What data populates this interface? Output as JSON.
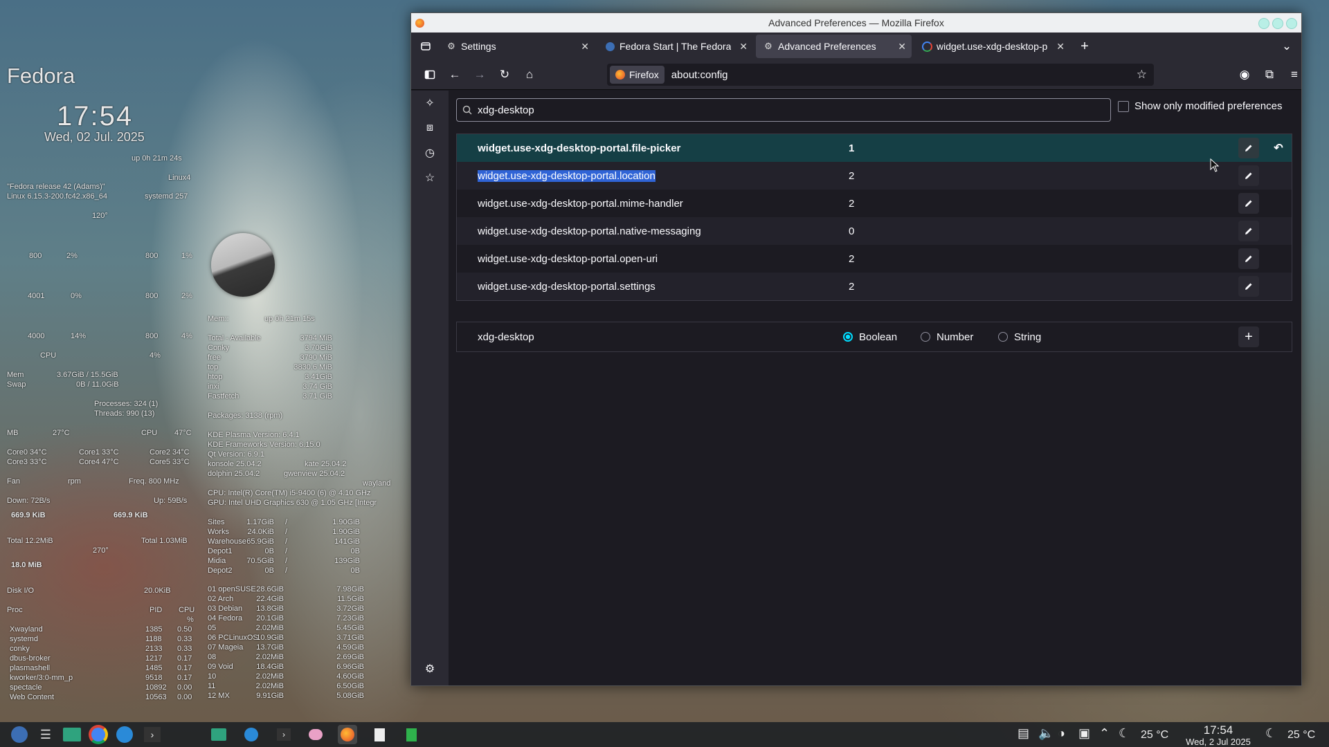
{
  "conky": {
    "distro_title": "Fedora",
    "time": "17:54",
    "date": "Wed, 02 Jul. 2025",
    "uptime": "up  0h 21m 24s",
    "kernel_short": "Linux4",
    "release": "\"Fedora release 42 (Adams)\"",
    "kernel": "Linux 6.15.3-200.fc42.x86_64",
    "systemd": "systemd 257",
    "angle_top": "120°",
    "cpu_rows": [
      {
        "a": "800",
        "b": "2%",
        "c": "800",
        "d": "1%"
      },
      {
        "a": "4001",
        "b": "0%",
        "c": "800",
        "d": "2%"
      },
      {
        "a": "4000",
        "b": "14%",
        "c": "800",
        "d": "4%"
      }
    ],
    "cpu_label": "CPU",
    "cpu_total": "4%",
    "mem_label": "Mem",
    "mem_value": "3.67GiB / 15.5GiB",
    "swap_label": "Swap",
    "swap_value": "0B / 11.0GiB",
    "processes": "Processes:   324 (1)",
    "threads": "Threads:   990 (13)",
    "mb_label": "MB",
    "mb_temp": "27°C",
    "cpu_temp_label": "CPU",
    "cpu_temp": "47°C",
    "cores": [
      "Core0  34°C",
      "Core1  33°C",
      "Core2  34°C",
      "Core3  33°C",
      "Core4  47°C",
      "Core5  33°C"
    ],
    "fan": "Fan",
    "rpm": "rpm",
    "freq": "Freq.  800   MHz",
    "down": "Down: 72B/s",
    "up": "Up: 59B/s",
    "down_kib": "669.9 KiB",
    "up_kib": "669.9 KiB",
    "total_down": "Total 12.2MiB",
    "total_up": "Total 1.03MiB",
    "angle_bottom": "270°",
    "io_mib": "18.0 MiB",
    "diskio_label": "Disk I/O",
    "diskio_value": "20.0KiB",
    "proc_header": {
      "name": "Proc",
      "pid": "PID",
      "cpu": "CPU",
      "pct": "%"
    },
    "procs": [
      {
        "name": "Xwayland",
        "pid": "1385",
        "cpu": "0.50"
      },
      {
        "name": "systemd",
        "pid": "1188",
        "cpu": "0.33"
      },
      {
        "name": "conky",
        "pid": "2133",
        "cpu": "0.33"
      },
      {
        "name": "dbus-broker",
        "pid": "1217",
        "cpu": "0.17"
      },
      {
        "name": "plasmashell",
        "pid": "1485",
        "cpu": "0.17"
      },
      {
        "name": "kworker/3:0-mm_p",
        "pid": "9518",
        "cpu": "0.17"
      },
      {
        "name": "spectacle",
        "pid": "10892",
        "cpu": "0.00"
      },
      {
        "name": "Web Content",
        "pid": "10563",
        "cpu": "0.00"
      }
    ],
    "mem_header": "Mem::",
    "mem_uptime": "up  0h 21m 15s",
    "mem_tools": [
      {
        "name": "Total - Available",
        "value": "3794  MiB"
      },
      {
        "name": "Conky",
        "value": "3.70GiB"
      },
      {
        "name": "free",
        "value": "3790   MiB"
      },
      {
        "name": "top",
        "value": "3830.6  MiB"
      },
      {
        "name": "htop",
        "value": "3.41GiB"
      },
      {
        "name": "inxi",
        "value": "3.74 GiB"
      },
      {
        "name": "Fastfetch",
        "value": "3.71 GiB"
      }
    ],
    "packages": "Packages: 3138 (rpm)",
    "versions": [
      "KDE Plasma Version: 6.4.1",
      "KDE Frameworks Version: 6.15.0",
      "Qt Version: 6.9.1"
    ],
    "konsole": "konsole 25.04.2",
    "kate": "kate 25.04.2",
    "dolphin": "dolphin 25.04.2",
    "gwenview": "gwenview 25.04.2",
    "session": "wayland",
    "cpu_model": "CPU: Intel(R) Core(TM) i5-9400 (6) @ 4.10 GHz",
    "gpu_model": "GPU: Intel UHD Graphics 630 @ 1.05 GHz [Integr",
    "disks": [
      {
        "name": "Sites",
        "used": "1.17GiB",
        "total": "1.90GiB"
      },
      {
        "name": "Works",
        "used": "24.0KiB",
        "total": "1.90GiB"
      },
      {
        "name": "Warehouse",
        "used": "65.9GiB",
        "total": "141GiB"
      },
      {
        "name": "Depot1",
        "used": "0B",
        "total": "0B"
      },
      {
        "name": "Midia",
        "used": "70.5GiB",
        "total": "139GiB"
      },
      {
        "name": "Depot2",
        "used": "0B",
        "total": "0B"
      }
    ],
    "partitions": [
      {
        "name": "01 openSUSE",
        "a": "28.6GiB",
        "b": "7.98GiB"
      },
      {
        "name": "02 Arch",
        "a": "22.4GiB",
        "b": "11.5GiB"
      },
      {
        "name": "03 Debian",
        "a": "13.8GiB",
        "b": "3.72GiB"
      },
      {
        "name": "04 Fedora",
        "a": "20.1GiB",
        "b": "7.23GiB"
      },
      {
        "name": "05",
        "a": "2.02MiB",
        "b": "5.45GiB"
      },
      {
        "name": "06 PCLinuxOS",
        "a": "10.9GiB",
        "b": "3.71GiB"
      },
      {
        "name": "07 Mageia",
        "a": "13.7GiB",
        "b": "4.59GiB"
      },
      {
        "name": "08",
        "a": "2.02MiB",
        "b": "2.69GiB"
      },
      {
        "name": "09 Void",
        "a": "18.4GiB",
        "b": "6.96GiB"
      },
      {
        "name": "10",
        "a": "2.02MiB",
        "b": "4.60GiB"
      },
      {
        "name": "11",
        "a": "2.02MiB",
        "b": "6.50GiB"
      },
      {
        "name": "12 MX",
        "a": "9.91GiB",
        "b": "5.08GiB"
      }
    ]
  },
  "window": {
    "title": "Advanced Preferences — Mozilla Firefox",
    "tabs": [
      {
        "label": "Settings",
        "icon": "gear-icon",
        "active": false
      },
      {
        "label": "Fedora Start | The Fedora",
        "icon": "fedora-icon",
        "active": false
      },
      {
        "label": "Advanced Preferences",
        "icon": "gear-icon",
        "active": true
      },
      {
        "label": "widget.use-xdg-desktop-p",
        "icon": "google-icon",
        "active": false
      }
    ],
    "identity_label": "Firefox",
    "url": "about:config"
  },
  "config": {
    "search_value": "xdg-desktop",
    "modified_only_label": "Show only modified preferences",
    "prefs": [
      {
        "name": "widget.use-xdg-desktop-portal.file-picker",
        "value": "1",
        "modified": true,
        "selected": false
      },
      {
        "name": "widget.use-xdg-desktop-portal.location",
        "value": "2",
        "modified": false,
        "selected": true
      },
      {
        "name": "widget.use-xdg-desktop-portal.mime-handler",
        "value": "2",
        "modified": false,
        "selected": false
      },
      {
        "name": "widget.use-xdg-desktop-portal.native-messaging",
        "value": "0",
        "modified": false,
        "selected": false
      },
      {
        "name": "widget.use-xdg-desktop-portal.open-uri",
        "value": "2",
        "modified": false,
        "selected": false
      },
      {
        "name": "widget.use-xdg-desktop-portal.settings",
        "value": "2",
        "modified": false,
        "selected": false
      }
    ],
    "new_pref_name": "xdg-desktop",
    "types": [
      {
        "label": "Boolean",
        "selected": true
      },
      {
        "label": "Number",
        "selected": false
      },
      {
        "label": "String",
        "selected": false
      }
    ]
  },
  "taskbar": {
    "temp1": "25 °C",
    "time": "17:54",
    "date": "Wed, 2 Jul 2025",
    "temp2": "25 °C"
  },
  "colors": {
    "accent": "#00ddff",
    "modified_row": "#153f45",
    "selection": "#3064d6"
  }
}
